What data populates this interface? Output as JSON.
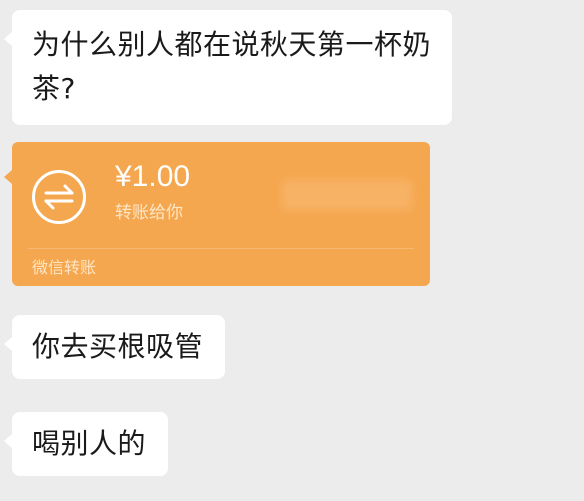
{
  "messages": [
    {
      "type": "text",
      "text": "为什么别人都在说秋天第一杯奶茶?"
    },
    {
      "type": "transfer",
      "amount": "¥1.00",
      "note": "转账给你",
      "footer": "微信转账",
      "icon": "transfer-arrows-icon",
      "color": "#f5a74f"
    },
    {
      "type": "text",
      "text": "你去买根吸管"
    },
    {
      "type": "text",
      "text": "喝别人的"
    }
  ]
}
